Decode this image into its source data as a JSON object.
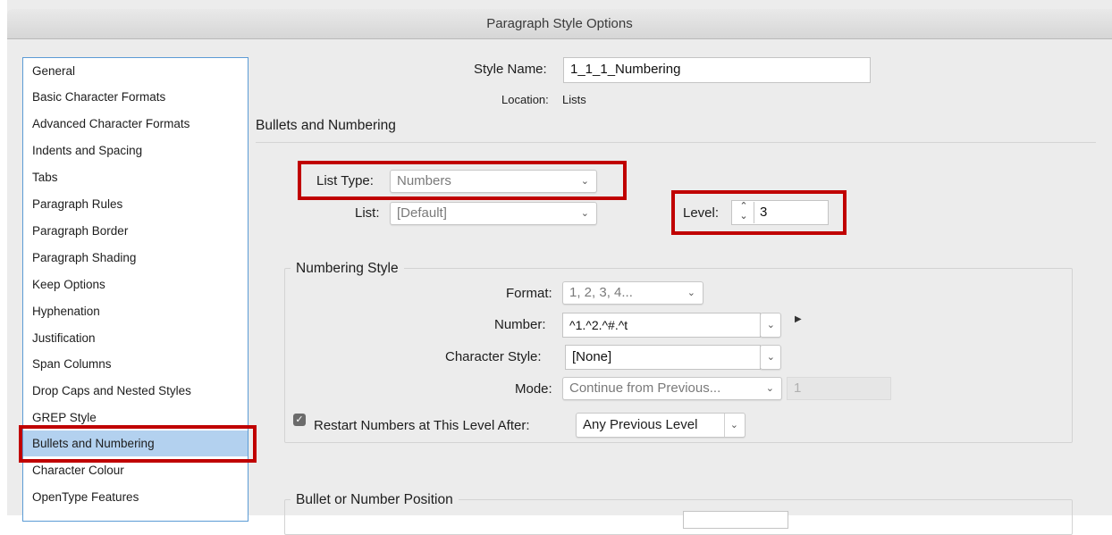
{
  "window": {
    "title": "Paragraph Style Options"
  },
  "sidebar": {
    "items": [
      {
        "label": "General"
      },
      {
        "label": "Basic Character Formats"
      },
      {
        "label": "Advanced Character Formats"
      },
      {
        "label": "Indents and Spacing"
      },
      {
        "label": "Tabs"
      },
      {
        "label": "Paragraph Rules"
      },
      {
        "label": "Paragraph Border"
      },
      {
        "label": "Paragraph Shading"
      },
      {
        "label": "Keep Options"
      },
      {
        "label": "Hyphenation"
      },
      {
        "label": "Justification"
      },
      {
        "label": "Span Columns"
      },
      {
        "label": "Drop Caps and Nested Styles"
      },
      {
        "label": "GREP Style"
      },
      {
        "label": "Bullets and Numbering"
      },
      {
        "label": "Character Colour"
      },
      {
        "label": "OpenType Features"
      }
    ],
    "selected": "Bullets and Numbering"
  },
  "header": {
    "style_name_label": "Style Name:",
    "style_name_value": "1_1_1_Numbering",
    "location_label": "Location:",
    "location_value": "Lists",
    "section_title": "Bullets and Numbering"
  },
  "list_settings": {
    "list_type_label": "List Type:",
    "list_type_value": "Numbers",
    "list_label": "List:",
    "list_value": "[Default]",
    "level_label": "Level:",
    "level_value": "3"
  },
  "numbering_style": {
    "legend": "Numbering Style",
    "format_label": "Format:",
    "format_value": "1, 2, 3, 4...",
    "number_label": "Number:",
    "number_value": "^1.^2.^#.^t",
    "char_style_label": "Character Style:",
    "char_style_value": "[None]",
    "mode_label": "Mode:",
    "mode_value": "Continue from Previous...",
    "mode_start_value": "1",
    "restart_label": "Restart Numbers at This Level After:",
    "restart_checked": true,
    "restart_value": "Any Previous Level"
  },
  "bullet_position": {
    "legend": "Bullet or Number Position"
  },
  "colors": {
    "highlight": "#c00000",
    "selection": "#b3d1ef",
    "accent": "#5b9bd5"
  },
  "icons": [
    "chevron-down-icon",
    "stepper-icon",
    "triangle-right-icon",
    "checkbox-checked-icon"
  ]
}
